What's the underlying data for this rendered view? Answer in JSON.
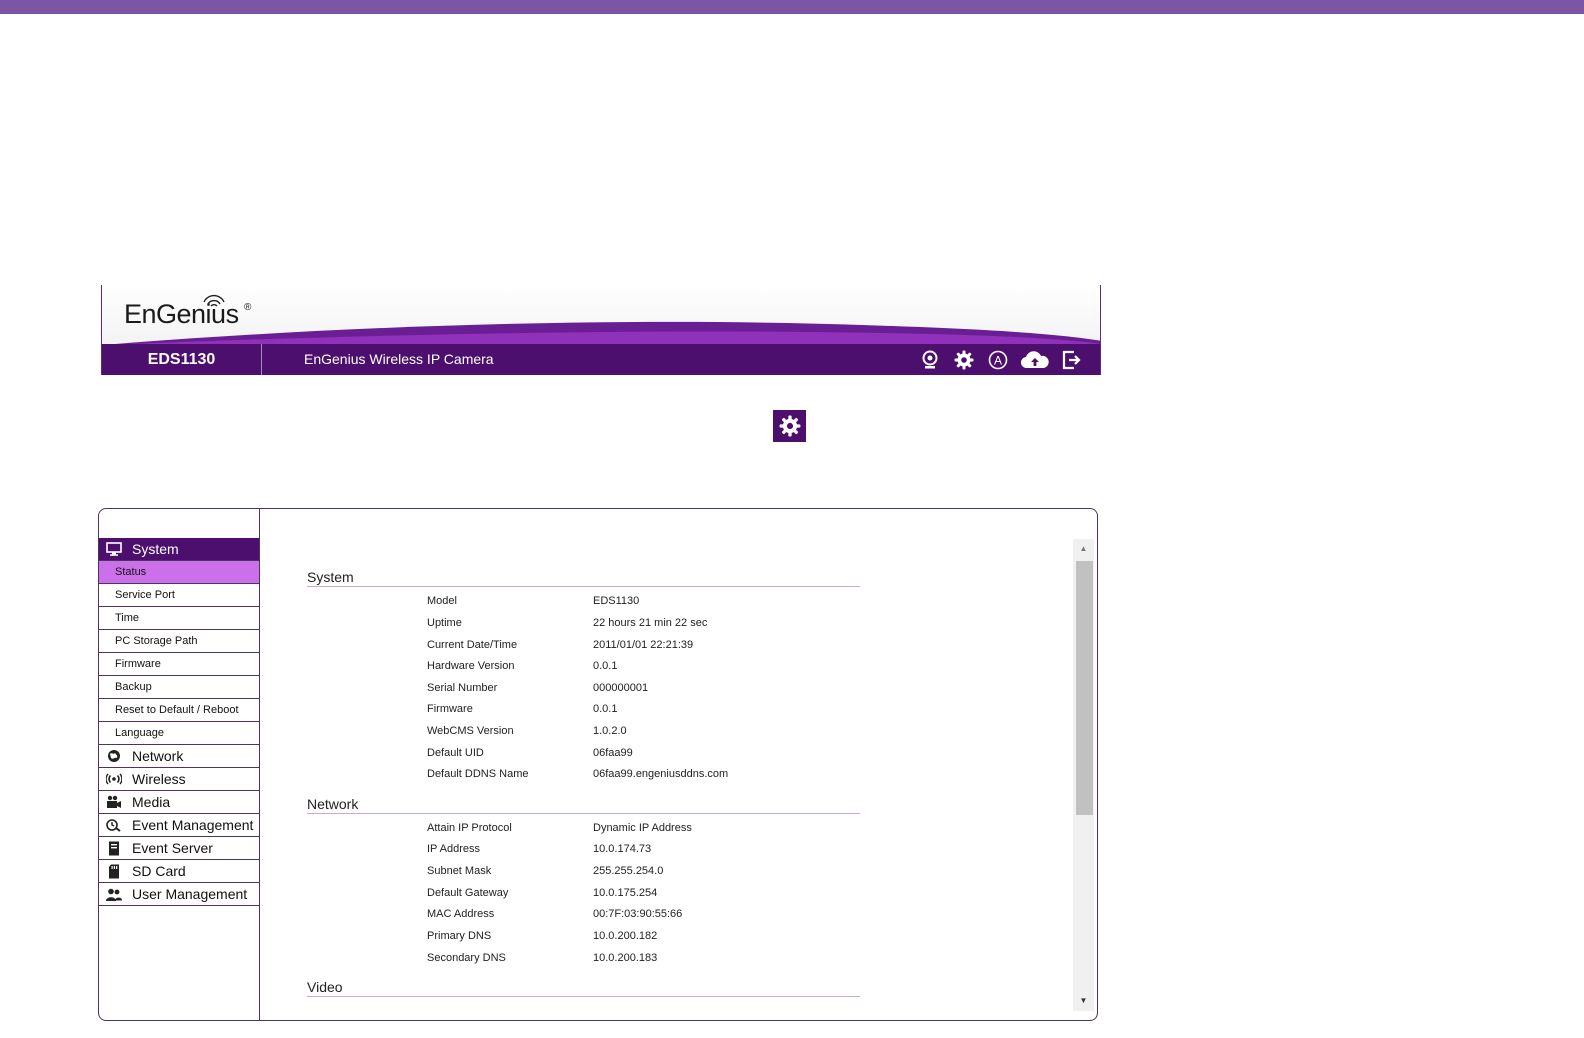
{
  "header": {
    "logo_text": "EnGenius",
    "logo_reg": "®",
    "model": "EDS1130",
    "product_name": "EnGenius Wireless IP Camera",
    "icons": [
      "webcam-icon",
      "gear-icon",
      "auto-a-icon",
      "cloud-upload-icon",
      "logout-icon"
    ],
    "brand_color": "#4c0f6e"
  },
  "sidebar": {
    "groups": [
      {
        "label": "System",
        "icon": "monitor-icon",
        "active": true,
        "items": [
          "Status",
          "Service Port",
          "Time",
          "PC Storage Path",
          "Firmware",
          "Backup",
          "Reset to Default / Reboot",
          "Language"
        ],
        "active_item": "Status"
      },
      {
        "label": "Network",
        "icon": "globe-icon"
      },
      {
        "label": "Wireless",
        "icon": "wireless-icon"
      },
      {
        "label": "Media",
        "icon": "media-icon"
      },
      {
        "label": "Event Management",
        "icon": "event-icon"
      },
      {
        "label": "Event Server",
        "icon": "server-icon"
      },
      {
        "label": "SD Card",
        "icon": "sdcard-icon"
      },
      {
        "label": "User Management",
        "icon": "users-icon"
      }
    ],
    "active_highlight": "#cc70ea"
  },
  "status": {
    "system": {
      "title": "System",
      "rows": [
        {
          "label": "Model",
          "value": "EDS1130"
        },
        {
          "label": "Uptime",
          "value": "22 hours 21 min 22 sec"
        },
        {
          "label": "Current Date/Time",
          "value": "2011/01/01 22:21:39"
        },
        {
          "label": "Hardware Version",
          "value": "0.0.1"
        },
        {
          "label": "Serial Number",
          "value": "000000001"
        },
        {
          "label": "Firmware",
          "value": "0.0.1"
        },
        {
          "label": "WebCMS Version",
          "value": "1.0.2.0"
        },
        {
          "label": "Default UID",
          "value": "06faa99"
        },
        {
          "label": "Default DDNS Name",
          "value": "06faa99.engeniusddns.com"
        }
      ]
    },
    "network": {
      "title": "Network",
      "rows": [
        {
          "label": "Attain IP Protocol",
          "value": "Dynamic IP Address"
        },
        {
          "label": "IP Address",
          "value": "10.0.174.73"
        },
        {
          "label": "Subnet Mask",
          "value": "255.255.254.0"
        },
        {
          "label": "Default Gateway",
          "value": "10.0.175.254"
        },
        {
          "label": "MAC Address",
          "value": "00:7F:03:90:55:66"
        },
        {
          "label": "Primary DNS",
          "value": "10.0.200.182"
        },
        {
          "label": "Secondary DNS",
          "value": "10.0.200.183"
        }
      ]
    },
    "video": {
      "title": "Video"
    }
  }
}
